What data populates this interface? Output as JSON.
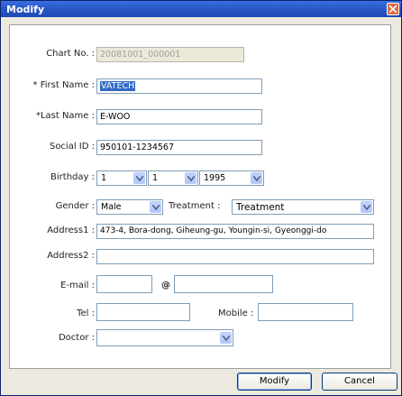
{
  "window": {
    "title": "Modify"
  },
  "form": {
    "chart_no": {
      "label": "Chart No. :",
      "value": "20081001_000001"
    },
    "first_name": {
      "label": "* First Name :",
      "value": "VATECH"
    },
    "last_name": {
      "label": "*Last Name :",
      "value": "E-WOO"
    },
    "social_id": {
      "label": "Social ID :",
      "value": "950101-1234567"
    },
    "birthday": {
      "label": "Birthday :",
      "month": "1",
      "day": "1",
      "year": "1995"
    },
    "gender": {
      "label": "Gender :",
      "value": "Male"
    },
    "treatment": {
      "label": "Treatment :",
      "value": "Treatment"
    },
    "address1": {
      "label": "Address1 :",
      "value": "473-4, Bora-dong, Giheung-gu, Youngin-si, Gyeonggi-do"
    },
    "address2": {
      "label": "Address2 :",
      "value": ""
    },
    "email": {
      "label": "E-mail :",
      "user": "",
      "at": "@",
      "domain": ""
    },
    "tel": {
      "label": "Tel :",
      "value": ""
    },
    "mobile": {
      "label": "Mobile :",
      "value": ""
    },
    "doctor": {
      "label": "Doctor :",
      "value": ""
    }
  },
  "buttons": {
    "modify": "Modify",
    "cancel": "Cancel"
  },
  "icons": {
    "close": "close-icon",
    "dropdown": "chevron-down-icon"
  },
  "colors": {
    "title_bar": "#2a58c8",
    "close_button": "#e06a3e",
    "selection": "#316ac5"
  }
}
